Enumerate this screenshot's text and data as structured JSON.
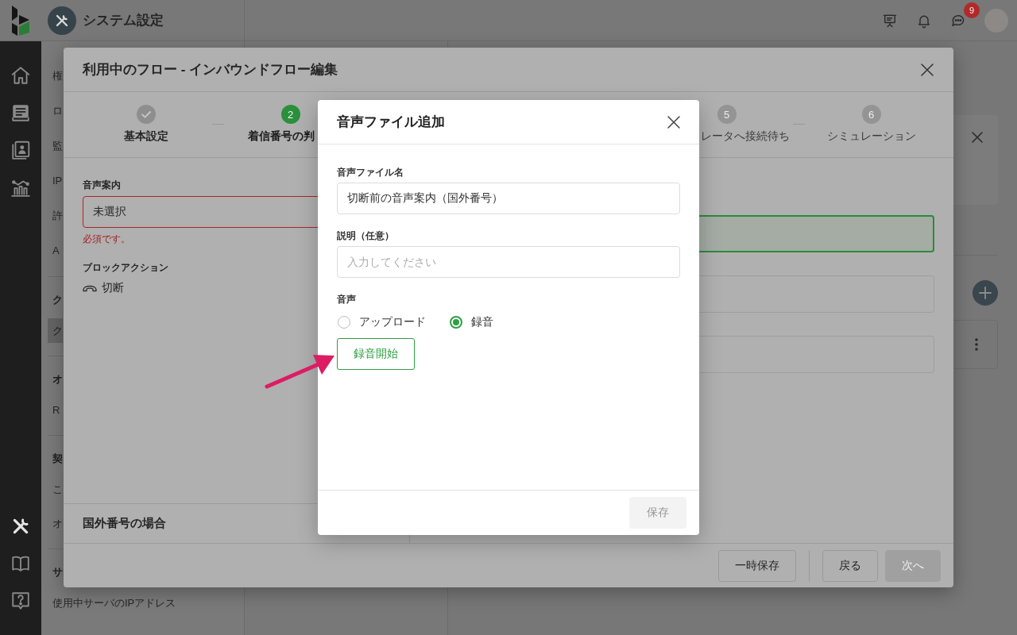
{
  "nav_rail": {
    "top": [
      {
        "kind": "home",
        "selected": false
      },
      {
        "kind": "board",
        "selected": false
      },
      {
        "kind": "contacts",
        "selected": false
      },
      {
        "kind": "chart",
        "selected": false
      }
    ],
    "bottom": [
      {
        "kind": "tools",
        "selected": true
      },
      {
        "kind": "book",
        "selected": false
      },
      {
        "kind": "help",
        "selected": false
      }
    ]
  },
  "header": {
    "title": "システム設定",
    "chat_badge": "9"
  },
  "settings_menu": {
    "sections": [
      {
        "items": [
          {
            "label": "権",
            "selected": false
          },
          {
            "label": "ロ",
            "selected": false
          },
          {
            "label": "監",
            "selected": false
          },
          {
            "label": "IP",
            "selected": false
          },
          {
            "label": "許",
            "selected": false
          },
          {
            "label": "A",
            "selected": false
          }
        ]
      },
      {
        "heading": "ク",
        "items": [
          {
            "label": "ク",
            "selected": true
          }
        ]
      },
      {
        "heading": "オ",
        "items": [
          {
            "label": "R",
            "selected": false
          }
        ]
      },
      {
        "heading": "契",
        "items": [
          {
            "label": "こ",
            "selected": false
          },
          {
            "label": "オ",
            "selected": false
          }
        ]
      },
      {
        "heading": "サ",
        "items": [
          {
            "label": "使用中サーバのIPアドレス",
            "selected": false
          }
        ]
      }
    ]
  },
  "flow_dialog": {
    "title": "利用中のフロー - インバウンドフロー編集",
    "steps_start": [
      {
        "completed": true,
        "active": false,
        "label": "基本設定"
      },
      {
        "completed": false,
        "active": true,
        "number": "2",
        "label": "着信番号の判"
      }
    ],
    "steps_end": [
      {
        "completed": false,
        "active": false,
        "number": "5",
        "label": "レータへ接続待ち"
      },
      {
        "completed": false,
        "active": false,
        "number": "6",
        "label": "シミュレーション"
      }
    ],
    "announcement": {
      "label": "音声案内",
      "value": "未選択",
      "error": "必須です。"
    },
    "block_action": {
      "label": "ブロックアクション",
      "action": "切断"
    },
    "section_title": "国外番号の場合",
    "fields": [
      {
        "focused": true
      },
      {
        "focused": false
      },
      {
        "focused": false
      }
    ],
    "draft_button": {
      "label": "一時保存",
      "disabled": false
    },
    "buttons": [
      {
        "label": "戻る",
        "disabled": false
      },
      {
        "label": "次へ",
        "disabled": true
      }
    ]
  },
  "audio_dialog": {
    "title": "音声ファイル追加",
    "fields": [
      {
        "label": "音声ファイル名",
        "value": "切断前の音声案内（国外番号）"
      },
      {
        "label": "説明（任意）",
        "placeholder": "入力してください"
      }
    ],
    "source": {
      "label": "音声",
      "options": [
        {
          "label": "アップロード",
          "selected": false
        },
        {
          "label": "録音",
          "selected": true
        }
      ]
    },
    "record_button": {
      "label": "録音開始"
    },
    "save_button": {
      "label": "保存",
      "disabled": true
    }
  }
}
